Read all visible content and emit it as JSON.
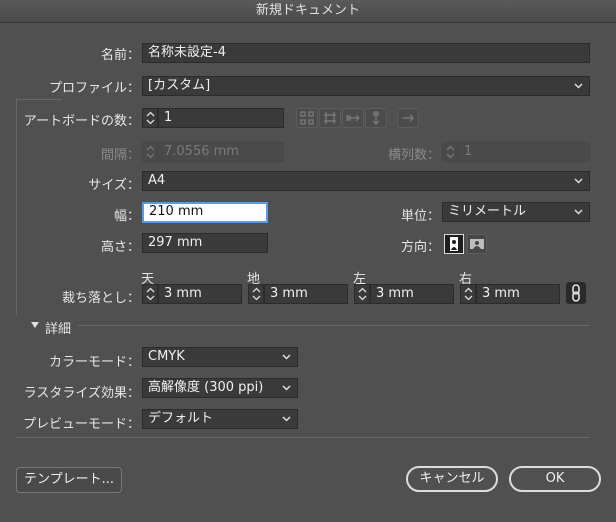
{
  "window": {
    "title": "新規ドキュメント"
  },
  "form": {
    "name_label": "名前：",
    "name_value": "名称未設定-4",
    "profile_label": "プロファイル：",
    "profile_value": "[カスタム]",
    "artboards_label": "アートボードの数：",
    "artboards_value": "1",
    "spacing_label": "間隔：",
    "spacing_value": "7.0556 mm",
    "columns_label": "横列数：",
    "columns_value": "1",
    "size_label": "サイズ：",
    "size_value": "A4",
    "width_label": "幅：",
    "width_value": "210 mm",
    "units_label": "単位：",
    "units_value": "ミリメートル",
    "height_label": "高さ：",
    "height_value": "297 mm",
    "orientation_label": "方向：",
    "bleed_label": "裁ち落とし：",
    "bleed": {
      "top_label": "天",
      "top_value": "3 mm",
      "bottom_label": "地",
      "bottom_value": "3 mm",
      "left_label": "左",
      "left_value": "3 mm",
      "right_label": "右",
      "right_value": "3 mm"
    }
  },
  "advanced": {
    "section_label": "詳細",
    "color_mode_label": "カラーモード：",
    "color_mode_value": "CMYK",
    "raster_label": "ラスタライズ効果：",
    "raster_value": "高解像度 (300 ppi)",
    "preview_label": "プレビューモード：",
    "preview_value": "デフォルト"
  },
  "buttons": {
    "templates": "テンプレート...",
    "cancel": "キャンセル",
    "ok": "OK"
  },
  "colors": {
    "focus": "#5a9ae0",
    "background": "#505050"
  }
}
